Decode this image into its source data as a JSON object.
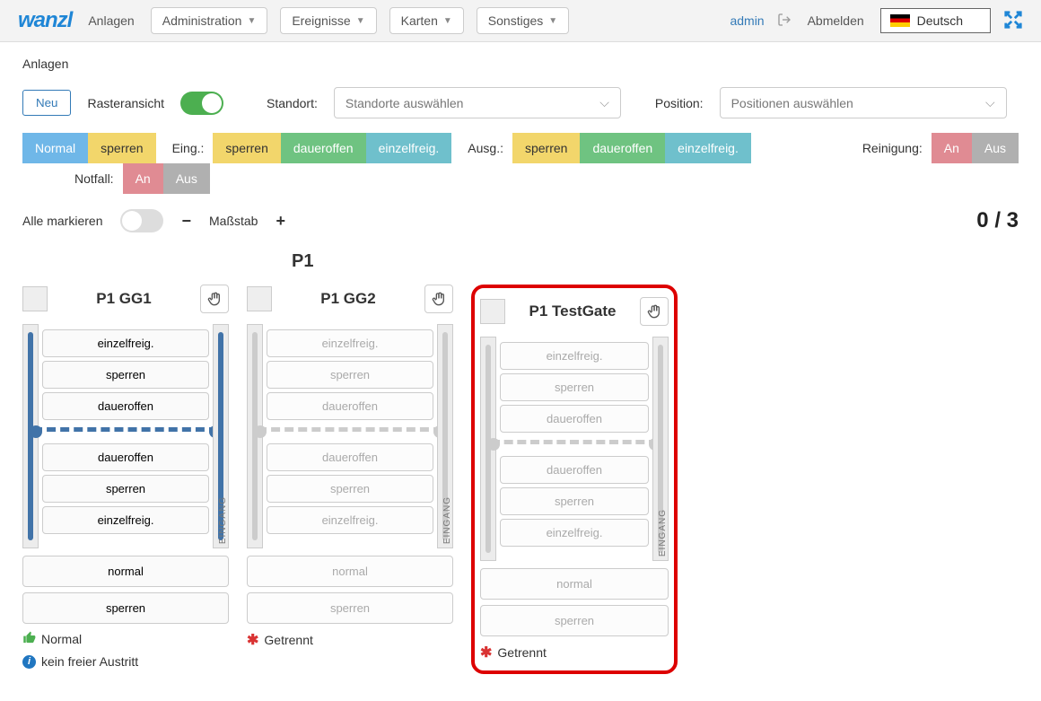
{
  "nav": {
    "anlagen": "Anlagen",
    "administration": "Administration",
    "ereignisse": "Ereignisse",
    "karten": "Karten",
    "sonstiges": "Sonstiges"
  },
  "user": {
    "name": "admin",
    "logout": "Abmelden"
  },
  "lang": {
    "label": "Deutsch"
  },
  "page_title": "Anlagen",
  "controls": {
    "new": "Neu",
    "raster": "Rasteransicht",
    "standort_label": "Standort:",
    "standort_placeholder": "Standorte auswählen",
    "position_label": "Position:",
    "position_placeholder": "Positionen auswählen"
  },
  "filters": {
    "normal": "Normal",
    "sperren": "sperren",
    "eing": "Eing.:",
    "daueroffen": "daueroffen",
    "einzelfreig": "einzelfreig.",
    "ausg": "Ausg.:",
    "reinigung": "Reinigung:",
    "an": "An",
    "aus": "Aus",
    "notfall": "Notfall:"
  },
  "scale": {
    "mark_all": "Alle markieren",
    "massstab": "Maßstab",
    "count": "0 / 3"
  },
  "group": "P1",
  "gate_labels": {
    "einzelfreig": "einzelfreig.",
    "sperren": "sperren",
    "daueroffen": "daueroffen",
    "normal": "normal",
    "eingang": "EINGANG"
  },
  "gates": [
    {
      "title": "P1 GG1",
      "active": true,
      "status1_icon": "thumb",
      "status1": "Normal",
      "status2_icon": "info",
      "status2": "kein freier Austritt"
    },
    {
      "title": "P1 GG2",
      "active": false,
      "status1_icon": "disconnect",
      "status1": "Getrennt"
    },
    {
      "title": "P1 TestGate",
      "active": false,
      "highlight": true,
      "status1_icon": "disconnect",
      "status1": "Getrennt"
    }
  ]
}
